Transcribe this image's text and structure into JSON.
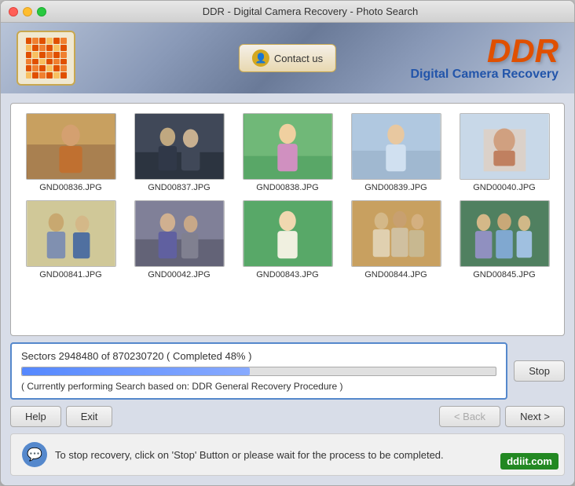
{
  "window": {
    "title": "DDR - Digital Camera Recovery - Photo Search"
  },
  "header": {
    "contact_button": "Contact us",
    "brand_title": "DDR",
    "brand_subtitle": "Digital Camera Recovery"
  },
  "photos": [
    {
      "id": 1,
      "name": "GND00836.JPG",
      "style": "p1"
    },
    {
      "id": 2,
      "name": "GND00837.JPG",
      "style": "p2"
    },
    {
      "id": 3,
      "name": "GND00838.JPG",
      "style": "p3"
    },
    {
      "id": 4,
      "name": "GND00839.JPG",
      "style": "p4"
    },
    {
      "id": 5,
      "name": "GND00040.JPG",
      "style": "p5"
    },
    {
      "id": 6,
      "name": "GND00841.JPG",
      "style": "p6"
    },
    {
      "id": 7,
      "name": "GND00042.JPG",
      "style": "p7"
    },
    {
      "id": 8,
      "name": "GND00843.JPG",
      "style": "p8"
    },
    {
      "id": 9,
      "name": "GND00844.JPG",
      "style": "p9"
    },
    {
      "id": 10,
      "name": "GND00845.JPG",
      "style": "p10"
    }
  ],
  "progress": {
    "status": "Sectors 2948480 of   870230720   ( Completed 48% )",
    "percent": 48,
    "message": "( Currently performing Search based on: DDR General Recovery Procedure )"
  },
  "buttons": {
    "help": "Help",
    "exit": "Exit",
    "back": "< Back",
    "next": "Next >",
    "stop": "Stop"
  },
  "info": {
    "message": "To stop recovery, click on 'Stop' Button or please wait for the process to be completed."
  },
  "watermark": "ddiit.com"
}
